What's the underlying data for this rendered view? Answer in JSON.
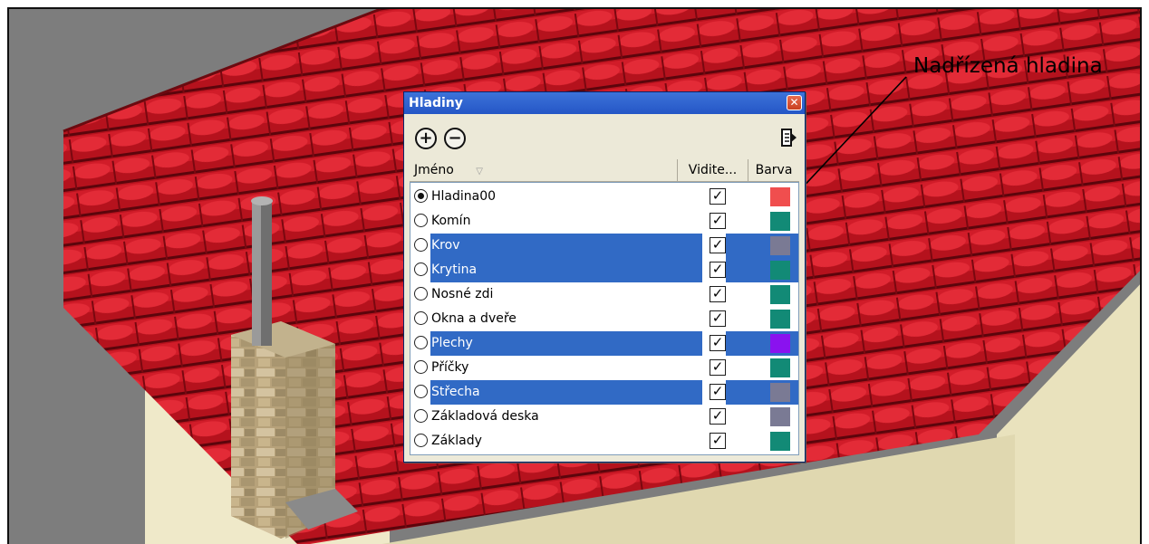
{
  "callout": {
    "text": "Nadřízená hladina"
  },
  "dialog": {
    "title": "Hladiny",
    "close_glyph": "✕",
    "toolbar": {
      "add_glyph": "+",
      "remove_glyph": "−",
      "detail_icon": "details-arrow-icon"
    },
    "columns": {
      "name": "Jméno",
      "sort_glyph": "▽",
      "visible": "Vidite...",
      "color": "Barva"
    },
    "layers": [
      {
        "name": "Hladina00",
        "active": true,
        "selected": false,
        "visible": true,
        "color": "#f04e4e"
      },
      {
        "name": "Komín",
        "active": false,
        "selected": false,
        "visible": true,
        "color": "#128a76"
      },
      {
        "name": "Krov",
        "active": false,
        "selected": true,
        "visible": true,
        "color": "#7a7a94"
      },
      {
        "name": "Krytina",
        "active": false,
        "selected": true,
        "visible": true,
        "color": "#128a76"
      },
      {
        "name": "Nosné zdi",
        "active": false,
        "selected": false,
        "visible": true,
        "color": "#128a76"
      },
      {
        "name": "Okna a dveře",
        "active": false,
        "selected": false,
        "visible": true,
        "color": "#128a76"
      },
      {
        "name": "Plechy",
        "active": false,
        "selected": true,
        "visible": true,
        "color": "#8a12ef"
      },
      {
        "name": "Příčky",
        "active": false,
        "selected": false,
        "visible": true,
        "color": "#128a76"
      },
      {
        "name": "Střecha",
        "active": false,
        "selected": true,
        "visible": true,
        "color": "#7a7a94"
      },
      {
        "name": "Základová deska",
        "active": false,
        "selected": false,
        "visible": true,
        "color": "#7a7a94"
      },
      {
        "name": "Základy",
        "active": false,
        "selected": false,
        "visible": true,
        "color": "#128a76"
      }
    ]
  }
}
